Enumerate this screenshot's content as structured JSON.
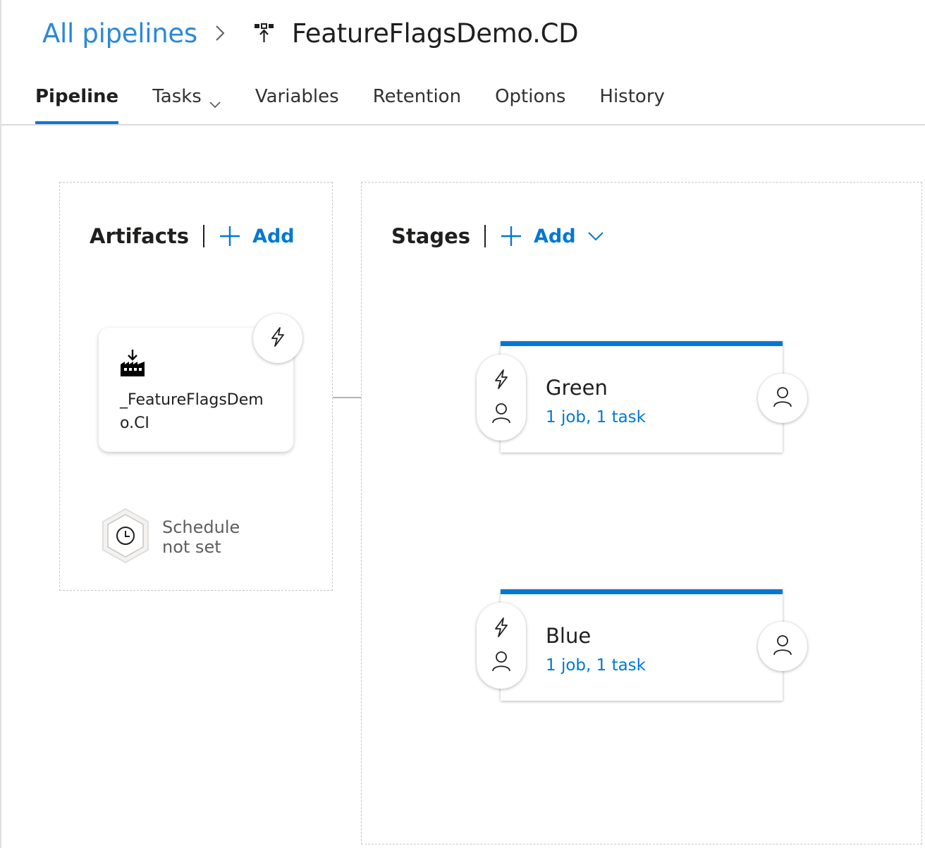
{
  "breadcrumb": {
    "parent": "All pipelines",
    "title": "FeatureFlagsDemo.CD"
  },
  "tabs": [
    {
      "label": "Pipeline",
      "active": true
    },
    {
      "label": "Tasks",
      "dropdown": true
    },
    {
      "label": "Variables"
    },
    {
      "label": "Retention"
    },
    {
      "label": "Options"
    },
    {
      "label": "History"
    }
  ],
  "artifacts": {
    "title": "Artifacts",
    "add_label": "Add",
    "items": [
      {
        "name": "_FeatureFlagsDemo.CI",
        "icon": "build-artifact-icon"
      }
    ],
    "schedule": {
      "line1": "Schedule",
      "line2": "not set"
    }
  },
  "stages": {
    "title": "Stages",
    "add_label": "Add",
    "items": [
      {
        "name": "Green",
        "detail": "1 job, 1 task"
      },
      {
        "name": "Blue",
        "detail": "1 job, 1 task"
      }
    ]
  },
  "colors": {
    "accent": "#0078d4",
    "link": "#2b88d8",
    "text": "#201f1e",
    "muted": "#605e5c"
  }
}
